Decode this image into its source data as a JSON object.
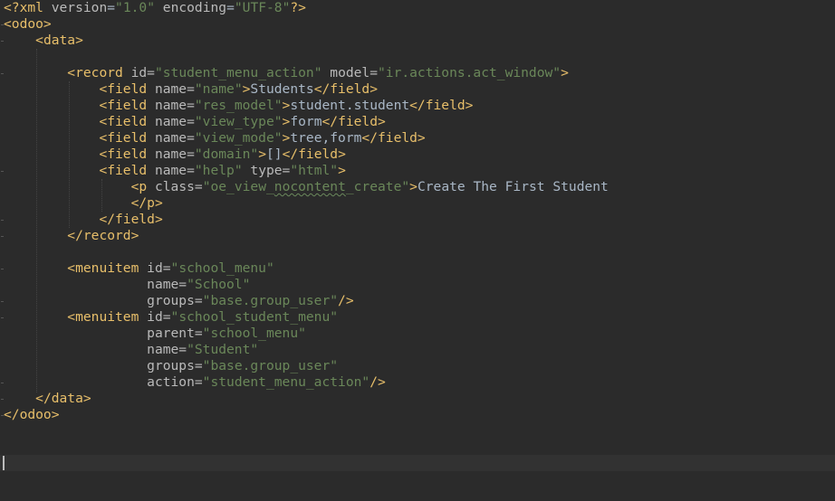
{
  "file": {
    "decl_open": "<?",
    "decl_name": "xml",
    "decl_version_attr": "version",
    "decl_version_value": "\"1.0\"",
    "decl_encoding_attr": "encoding",
    "decl_encoding_value": "\"UTF-8\"",
    "decl_close": "?>",
    "odoo_open": "<odoo>",
    "data_open": "<data>",
    "record_open": "<record",
    "record_id_attr": "id=",
    "record_id_value": "\"student_menu_action\"",
    "record_model_attr": "model=",
    "record_model_value": "\"ir.actions.act_window\"",
    "gt": ">",
    "field_open": "<field",
    "name_attr": "name=",
    "field_close": "</field>",
    "field_name_value": "\"name\"",
    "field_name_text": "Students",
    "field_res_model_value": "\"res_model\"",
    "field_res_model_text": "student.student",
    "field_view_type_value": "\"view_type\"",
    "field_view_type_text": "form",
    "field_view_mode_value": "\"view_mode\"",
    "field_view_mode_text": "tree,form",
    "field_domain_value": "\"domain\"",
    "field_domain_text": "[]",
    "field_help_value": "\"help\"",
    "type_attr": "type=",
    "field_help_type_value": "\"html\"",
    "p_open": "<p",
    "class_attr": "class=",
    "p_class_value_q1": "\"",
    "p_class_value_a": "oe_view_",
    "p_class_value_b": "nocontent",
    "p_class_value_c": "_create",
    "p_class_value_q2": "\"",
    "p_text": "Create The First Student",
    "p_close": "</p>",
    "record_close": "</record>",
    "menuitem_open": "<menuitem",
    "id_attr": "id=",
    "menu1_id_value": "\"school_menu\"",
    "menu1_name_value": "\"School\"",
    "groups_attr": "groups=",
    "menu1_groups_value": "\"base.group_user\"",
    "selfclose": "/>",
    "menu2_id_value": "\"school_student_menu\"",
    "parent_attr": "parent=",
    "menu2_parent_value": "\"school_menu\"",
    "menu2_name_value": "\"Student\"",
    "menu2_groups_value": "\"base.group_user\"",
    "action_attr": "action=",
    "menu2_action_value": "\"student_menu_action\"",
    "data_close": "</data>",
    "odoo_close": "</odoo>"
  },
  "colors": {
    "background": "#2b2b2b",
    "tag": "#e8bf6a",
    "attribute": "#bababa",
    "string": "#6a8759",
    "text": "#a9b7c6",
    "current_line": "#323232"
  }
}
